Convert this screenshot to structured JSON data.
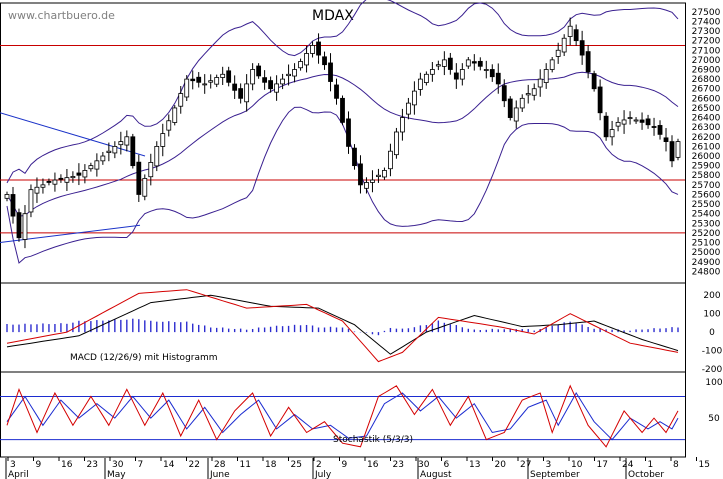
{
  "header": {
    "watermark": "www.chartbuero.de",
    "title": "MDAX"
  },
  "colors": {
    "candle_up": "#ffffff",
    "candle_down": "#000000",
    "bollinger": "#3a2090",
    "trendline": "#1a32c8",
    "support_line": "#c80000",
    "macd_signal": "#000000",
    "macd_line": "#d40000",
    "histogram": "#2c2ccf",
    "stoch_k": "#d40000",
    "stoch_d": "#1c2cd0",
    "stoch_level": "#1c2cd0",
    "grid": "#bdbdbd"
  },
  "chart_data": [
    {
      "type": "candlestick",
      "title": "MDAX",
      "ylim": [
        24700,
        27550
      ],
      "y_ticks": [
        24800,
        24900,
        25000,
        25100,
        25200,
        25300,
        25400,
        25500,
        25600,
        25700,
        25800,
        25900,
        26000,
        26100,
        26200,
        26300,
        26400,
        26500,
        26600,
        26700,
        26800,
        26900,
        27000,
        27100,
        27200,
        27300,
        27400,
        27500
      ],
      "horizontal_levels": [
        27150,
        25750,
        25200
      ],
      "overlays": [
        "Bollinger Bands (upper, middle, lower)",
        "Trendlines"
      ],
      "close_series": {
        "sessions": 113,
        "anchors": [
          [
            0,
            25600
          ],
          [
            2,
            25150
          ],
          [
            4,
            25650
          ],
          [
            8,
            25750
          ],
          [
            12,
            25800
          ],
          [
            16,
            26000
          ],
          [
            20,
            26200
          ],
          [
            22,
            25600
          ],
          [
            25,
            26100
          ],
          [
            28,
            26500
          ],
          [
            30,
            26800
          ],
          [
            33,
            26750
          ],
          [
            36,
            26850
          ],
          [
            39,
            26600
          ],
          [
            41,
            26900
          ],
          [
            44,
            26700
          ],
          [
            48,
            26900
          ],
          [
            51,
            27150
          ],
          [
            53,
            26950
          ],
          [
            55,
            26600
          ],
          [
            57,
            26100
          ],
          [
            59,
            25700
          ],
          [
            61,
            25750
          ],
          [
            63,
            25850
          ],
          [
            65,
            26250
          ],
          [
            67,
            26550
          ],
          [
            69,
            26800
          ],
          [
            71,
            26900
          ],
          [
            73,
            27000
          ],
          [
            75,
            26800
          ],
          [
            77,
            27000
          ],
          [
            80,
            26900
          ],
          [
            82,
            26750
          ],
          [
            84,
            26400
          ],
          [
            86,
            26600
          ],
          [
            88,
            26700
          ],
          [
            90,
            26900
          ],
          [
            92,
            27100
          ],
          [
            94,
            27350
          ],
          [
            96,
            27050
          ],
          [
            98,
            26700
          ],
          [
            100,
            26200
          ],
          [
            102,
            26350
          ],
          [
            104,
            26400
          ],
          [
            106,
            26350
          ],
          [
            108,
            26300
          ],
          [
            110,
            26150
          ],
          [
            111,
            25950
          ],
          [
            112,
            26150
          ]
        ]
      }
    },
    {
      "type": "line",
      "title": "MACD (12/26/9) mit Histogramm",
      "ylim": [
        -200,
        250
      ],
      "y_ticks": [
        -200,
        -100,
        0,
        100,
        200
      ],
      "series": [
        {
          "values_anchor": [
            [
              0,
              -60
            ],
            [
              10,
              0
            ],
            [
              22,
              210
            ],
            [
              30,
              230
            ],
            [
              40,
              130
            ],
            [
              50,
              150
            ],
            [
              56,
              60
            ],
            [
              62,
              -160
            ],
            [
              66,
              -110
            ],
            [
              72,
              80
            ],
            [
              82,
              30
            ],
            [
              88,
              -10
            ],
            [
              94,
              100
            ],
            [
              104,
              -60
            ],
            [
              112,
              -110
            ]
          ]
        },
        {
          "values_anchor": [
            [
              0,
              -80
            ],
            [
              12,
              -20
            ],
            [
              24,
              160
            ],
            [
              34,
              200
            ],
            [
              44,
              140
            ],
            [
              52,
              130
            ],
            [
              58,
              40
            ],
            [
              64,
              -120
            ],
            [
              70,
              0
            ],
            [
              78,
              90
            ],
            [
              86,
              30
            ],
            [
              92,
              40
            ],
            [
              98,
              60
            ],
            [
              106,
              -40
            ],
            [
              112,
              -100
            ]
          ]
        }
      ]
    },
    {
      "type": "line",
      "title": "Stochastik (5/3/3)",
      "ylim": [
        0,
        110
      ],
      "y_ticks": [
        50,
        100
      ],
      "levels": [
        80,
        20
      ],
      "series": [
        {
          "values_anchor": [
            [
              0,
              40
            ],
            [
              2,
              90
            ],
            [
              5,
              30
            ],
            [
              8,
              85
            ],
            [
              11,
              40
            ],
            [
              14,
              80
            ],
            [
              17,
              40
            ],
            [
              20,
              90
            ],
            [
              23,
              40
            ],
            [
              26,
              85
            ],
            [
              29,
              25
            ],
            [
              32,
              75
            ],
            [
              35,
              20
            ],
            [
              38,
              60
            ],
            [
              41,
              85
            ],
            [
              44,
              25
            ],
            [
              47,
              65
            ],
            [
              50,
              30
            ],
            [
              53,
              45
            ],
            [
              56,
              15
            ],
            [
              59,
              10
            ],
            [
              62,
              80
            ],
            [
              65,
              95
            ],
            [
              68,
              55
            ],
            [
              71,
              90
            ],
            [
              74,
              40
            ],
            [
              77,
              80
            ],
            [
              80,
              20
            ],
            [
              83,
              30
            ],
            [
              86,
              75
            ],
            [
              89,
              85
            ],
            [
              91,
              30
            ],
            [
              94,
              95
            ],
            [
              97,
              40
            ],
            [
              100,
              10
            ],
            [
              103,
              60
            ],
            [
              106,
              30
            ],
            [
              108,
              50
            ],
            [
              110,
              30
            ],
            [
              112,
              60
            ]
          ]
        },
        {
          "values_anchor": [
            [
              0,
              45
            ],
            [
              3,
              80
            ],
            [
              6,
              40
            ],
            [
              9,
              75
            ],
            [
              12,
              50
            ],
            [
              15,
              70
            ],
            [
              18,
              50
            ],
            [
              21,
              80
            ],
            [
              24,
              50
            ],
            [
              27,
              75
            ],
            [
              30,
              35
            ],
            [
              33,
              65
            ],
            [
              36,
              30
            ],
            [
              39,
              55
            ],
            [
              42,
              75
            ],
            [
              45,
              35
            ],
            [
              48,
              55
            ],
            [
              51,
              35
            ],
            [
              54,
              40
            ],
            [
              57,
              22
            ],
            [
              60,
              25
            ],
            [
              63,
              70
            ],
            [
              66,
              85
            ],
            [
              69,
              60
            ],
            [
              72,
              80
            ],
            [
              75,
              50
            ],
            [
              78,
              70
            ],
            [
              81,
              30
            ],
            [
              84,
              35
            ],
            [
              87,
              65
            ],
            [
              90,
              75
            ],
            [
              92,
              40
            ],
            [
              95,
              85
            ],
            [
              98,
              45
            ],
            [
              101,
              20
            ],
            [
              104,
              50
            ],
            [
              107,
              35
            ],
            [
              109,
              45
            ],
            [
              111,
              35
            ],
            [
              112,
              50
            ]
          ]
        }
      ]
    }
  ],
  "x_axis": {
    "day_labels": [
      "3",
      "9",
      "16",
      "23",
      "30",
      "7",
      "14",
      "22",
      "28",
      "11",
      "18",
      "25",
      "2",
      "9",
      "16",
      "23",
      "30",
      "6",
      "13",
      "20",
      "27",
      "3",
      "10",
      "17",
      "24",
      "1",
      "8",
      "15"
    ],
    "month_labels": [
      "April",
      "May",
      "June",
      "July",
      "August",
      "September",
      "October"
    ]
  }
}
